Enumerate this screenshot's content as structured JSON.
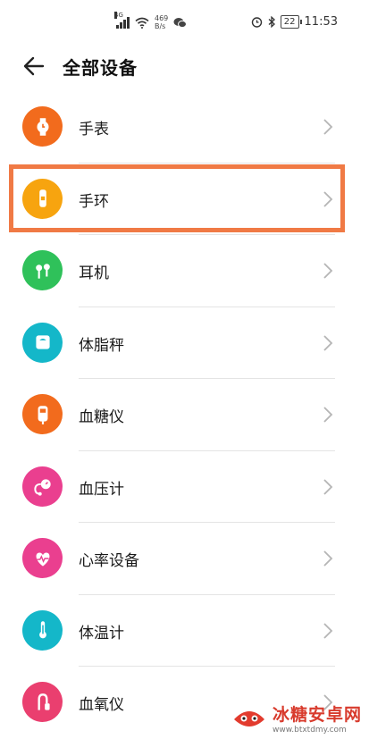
{
  "status_bar": {
    "network_type": "4G",
    "speed_value": "469",
    "speed_unit": "B/s",
    "battery": "22",
    "time": "11:53"
  },
  "header": {
    "title": "全部设备"
  },
  "devices": [
    {
      "label": "手表",
      "color": "#f26b1d",
      "icon": "watch-icon"
    },
    {
      "label": "手环",
      "color": "#f7a40f",
      "icon": "band-icon"
    },
    {
      "label": "耳机",
      "color": "#2fc15a",
      "icon": "earphone-icon"
    },
    {
      "label": "体脂秤",
      "color": "#14b7c9",
      "icon": "scale-icon"
    },
    {
      "label": "血糖仪",
      "color": "#f26b1d",
      "icon": "glucose-meter-icon"
    },
    {
      "label": "血压计",
      "color": "#ea3f8f",
      "icon": "blood-pressure-icon"
    },
    {
      "label": "心率设备",
      "color": "#ea3f8f",
      "icon": "heart-rate-icon"
    },
    {
      "label": "体温计",
      "color": "#14b7c9",
      "icon": "thermometer-icon"
    },
    {
      "label": "血氧仪",
      "color": "#ea3f6f",
      "icon": "oximeter-icon"
    }
  ],
  "highlight_color": "#f07a45",
  "watermark": {
    "name": "冰糖安卓网",
    "url": "www.btxtdmy.com"
  }
}
